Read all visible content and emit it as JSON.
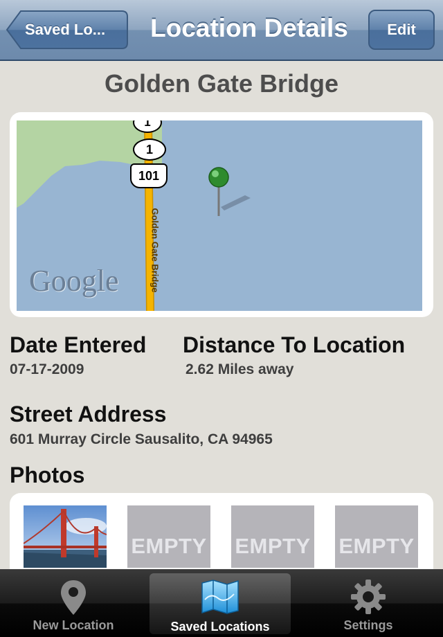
{
  "navbar": {
    "back_label": "Saved Lo...",
    "title": "Location Details",
    "edit_label": "Edit"
  },
  "location": {
    "name": "Golden Gate Bridge"
  },
  "map": {
    "road_name": "Golden Gate Bridge",
    "route_shields": [
      "1",
      "1",
      "101"
    ],
    "watermark": "Google",
    "pin_color": "#2e8b2e"
  },
  "details": {
    "date_heading": "Date Entered",
    "date_value": "07-17-2009",
    "distance_heading": "Distance To Location",
    "distance_value": "2.62 Miles away",
    "address_heading": "Street Address",
    "address_value": "601 Murray Circle Sausalito, CA 94965",
    "photos_heading": "Photos"
  },
  "photos": {
    "empty_label": "EMPTY",
    "slots": [
      "photo",
      "EMPTY",
      "EMPTY",
      "EMPTY"
    ]
  },
  "tabbar": {
    "tabs": [
      {
        "label": "New Location",
        "icon": "map-marker-icon",
        "selected": false
      },
      {
        "label": "Saved Locations",
        "icon": "folded-map-icon",
        "selected": true
      },
      {
        "label": "Settings",
        "icon": "gear-icon",
        "selected": false
      }
    ]
  },
  "colors": {
    "nav_blue": "#6d8aac",
    "background": "#e1dfd9",
    "water": "#98b5d2",
    "land": "#b4d4a3",
    "road": "#f5b400",
    "empty_slot": "#b5b4b9"
  }
}
